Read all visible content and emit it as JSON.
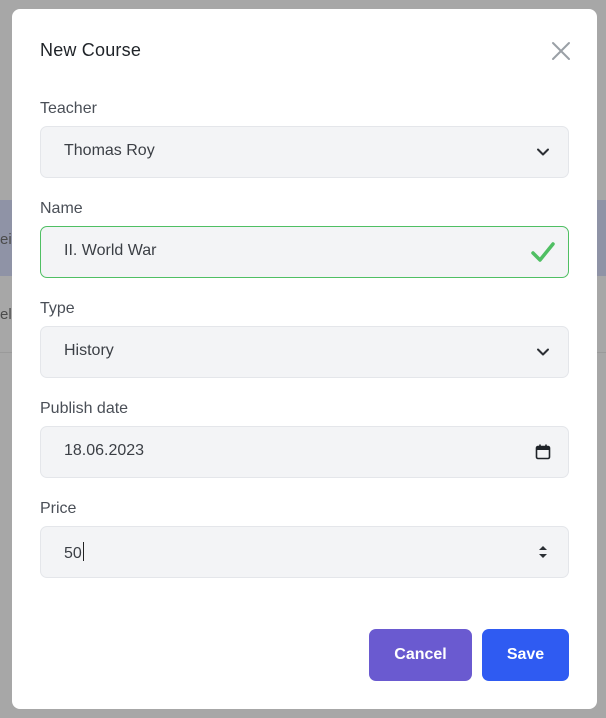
{
  "background": {
    "fragment_1": "ein",
    "fragment_2": "el"
  },
  "modal": {
    "title": "New Course",
    "fields": {
      "teacher": {
        "label": "Teacher",
        "value": "Thomas Roy"
      },
      "name": {
        "label": "Name",
        "value": "II. World War",
        "status": "valid"
      },
      "type": {
        "label": "Type",
        "value": "History"
      },
      "publish_date": {
        "label": "Publish date",
        "value": "18.06.2023"
      },
      "price": {
        "label": "Price",
        "value": "50"
      }
    },
    "buttons": {
      "cancel": "Cancel",
      "save": "Save"
    }
  },
  "colors": {
    "cancel_button": "#6a5ad0",
    "save_button": "#2f5bf2",
    "valid_border": "#4fbf63",
    "valid_check": "#4fbf63"
  },
  "icons": {
    "close": "close-icon",
    "dropdown": "chevron-down-icon",
    "calendar": "calendar-icon",
    "stepper": "number-stepper-icon",
    "valid": "check-icon"
  }
}
